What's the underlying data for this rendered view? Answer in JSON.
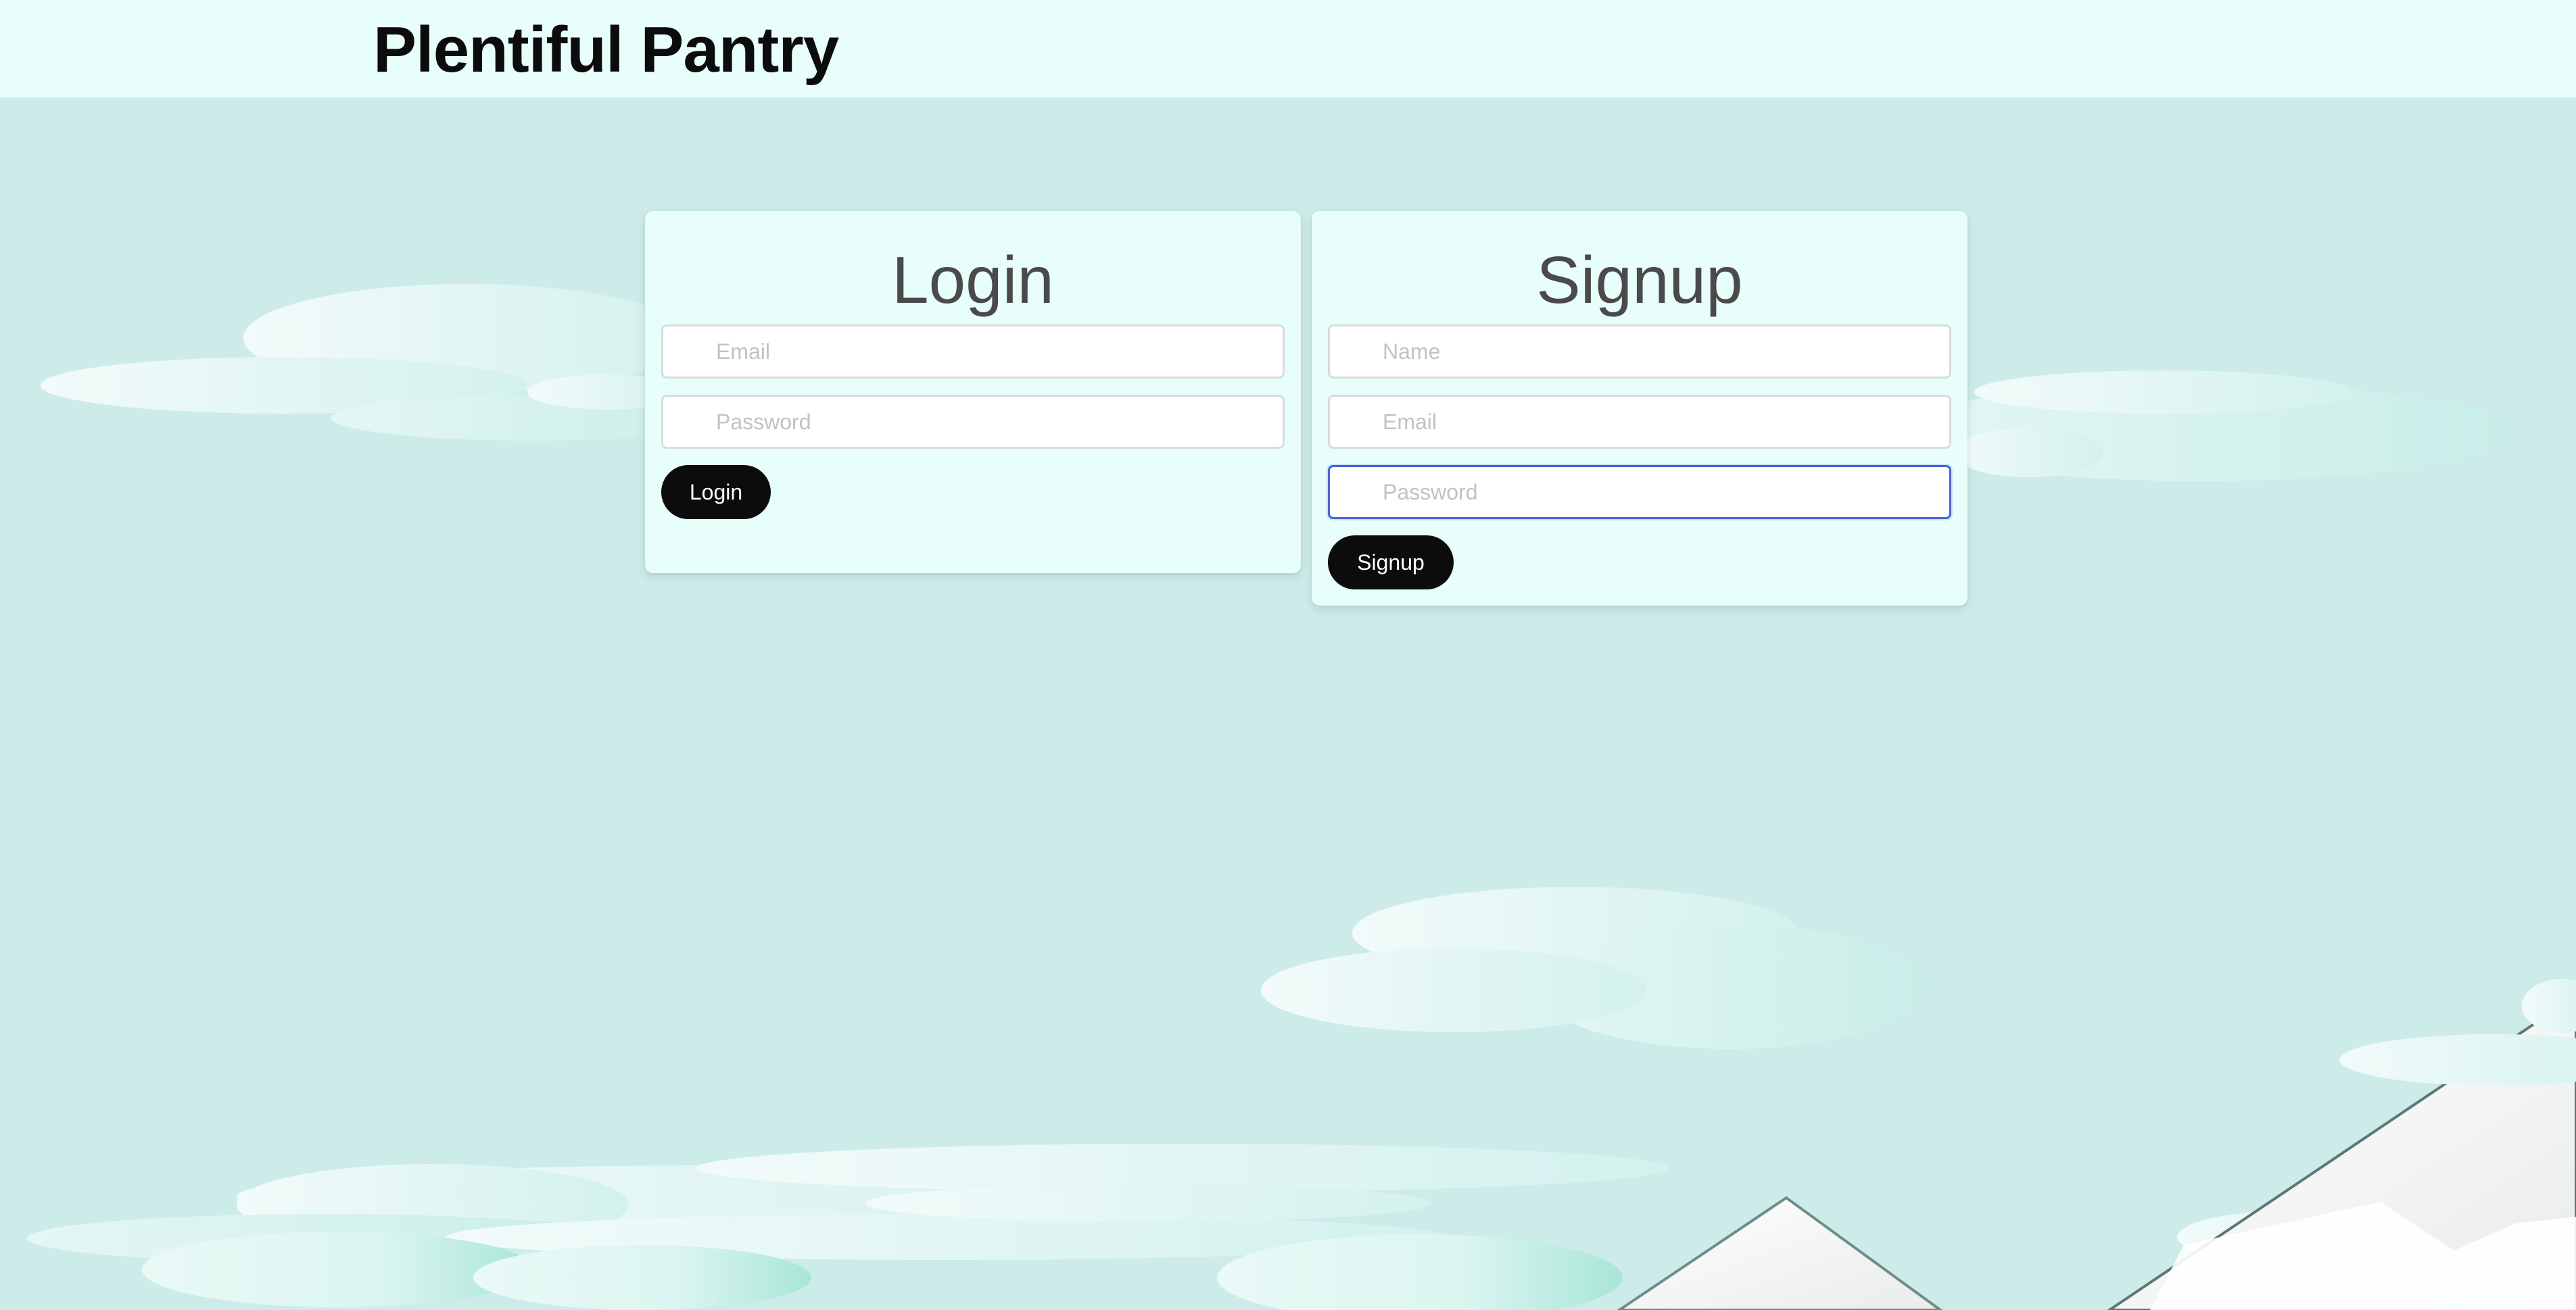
{
  "header": {
    "brand": "Plentiful Pantry"
  },
  "login": {
    "title": "Login",
    "email_placeholder": "Email",
    "password_placeholder": "Password",
    "button_label": "Login"
  },
  "signup": {
    "title": "Signup",
    "name_placeholder": "Name",
    "email_placeholder": "Email",
    "password_placeholder": "Password",
    "button_label": "Signup"
  },
  "colors": {
    "background": "#cdece9",
    "header_bg": "#e8fefb",
    "card_bg": "#e8fefb",
    "button_bg": "#0c0c0c",
    "focus_border": "#4a62d6"
  }
}
